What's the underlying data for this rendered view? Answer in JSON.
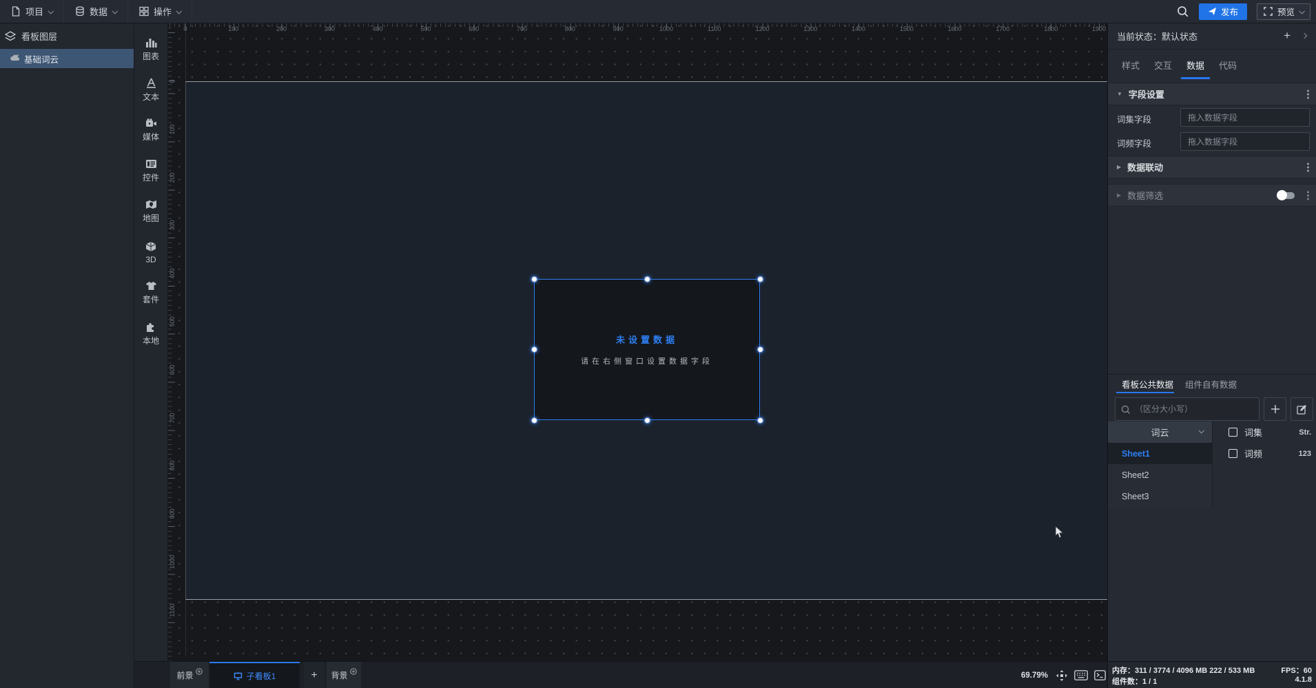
{
  "accent_colors": {
    "primary_blue": "#2878f0",
    "publish_button": "#2173e8",
    "selection_blue": "#2e7ff2"
  },
  "topbar": {
    "menus": [
      {
        "label": "项目"
      },
      {
        "label": "数据"
      },
      {
        "label": "操作"
      }
    ],
    "publish_label": "发布",
    "preview_label": "预览"
  },
  "left_panel": {
    "title": "看板图层",
    "layers": [
      {
        "label": "基础词云",
        "selected": true
      }
    ]
  },
  "toolbar": {
    "items": [
      "图表",
      "文本",
      "媒体",
      "控件",
      "地图",
      "3D",
      "套件",
      "本地"
    ]
  },
  "canvas": {
    "ruler_h": [
      "0",
      "100",
      "200",
      "300",
      "400",
      "500",
      "600",
      "700",
      "800",
      "900",
      "1000",
      "1100",
      "1200",
      "1300",
      "1400",
      "1500",
      "1600",
      "1700",
      "1800",
      "1900"
    ],
    "ruler_v": [
      "0",
      "100",
      "200",
      "300",
      "400",
      "500",
      "600",
      "700",
      "800",
      "900",
      "1000",
      "1100"
    ],
    "component": {
      "title": "未设置数据",
      "hint": "请在右侧窗口设置数据字段"
    }
  },
  "right_panel": {
    "state_label": "当前状态：",
    "state_value": "默认状态",
    "tabs": [
      "样式",
      "交互",
      "数据",
      "代码"
    ],
    "active_tab": "数据",
    "field_settings": {
      "title": "字段设置",
      "rows": [
        {
          "label": "词集字段",
          "placeholder": "拖入数据字段"
        },
        {
          "label": "词频字段",
          "placeholder": "拖入数据字段"
        }
      ]
    },
    "data_link_title": "数据联动",
    "data_filter_title": "数据筛选",
    "data_filter_enabled": false,
    "data_panel": {
      "tabs": [
        "看板公共数据",
        "组件自有数据"
      ],
      "active_tab": "看板公共数据",
      "search_placeholder": "（区分大小写）",
      "dataset_name": "词云",
      "sheets": [
        "Sheet1",
        "Sheet2",
        "Sheet3"
      ],
      "active_sheet": "Sheet1",
      "fields": [
        {
          "name": "词集",
          "type": "Str."
        },
        {
          "name": "词频",
          "type": "123"
        }
      ]
    }
  },
  "bottombar": {
    "foreground_label": "前景",
    "active_tab_label": "子看板1",
    "background_label": "背景",
    "zoom_level": "69.79%"
  },
  "statusbar": {
    "memory_label": "内存：",
    "memory_value": "311 / 3774 / 4096 MB  222 / 533 MB",
    "fps_label": "FPS：",
    "fps_value": "60",
    "components_label": "组件数：",
    "components_value": "1 / 1",
    "version": "4.1.8"
  },
  "icons": {
    "file-icon": "document sheet",
    "database-icon": "cylinder",
    "grid-icon": "four squares",
    "search-icon": "magnifier",
    "send-icon": "paper plane",
    "fullscreen-icon": "corner brackets",
    "layers-icon": "stacked layers",
    "wordcloud-icon": "word cloud",
    "chart-icon": "bars",
    "text-icon": "letter A",
    "media-icon": "video camera",
    "widget-icon": "panel list",
    "map-icon": "folded map",
    "cube-icon": "3d cube",
    "kit-icon": "t-shirt",
    "puzzle-icon": "puzzle piece",
    "fit-screen-icon": "expand arrows",
    "keyboard-icon": "keyboard",
    "terminal-icon": "console",
    "board-icon": "easel board",
    "plus-circle-icon": "circled plus"
  }
}
